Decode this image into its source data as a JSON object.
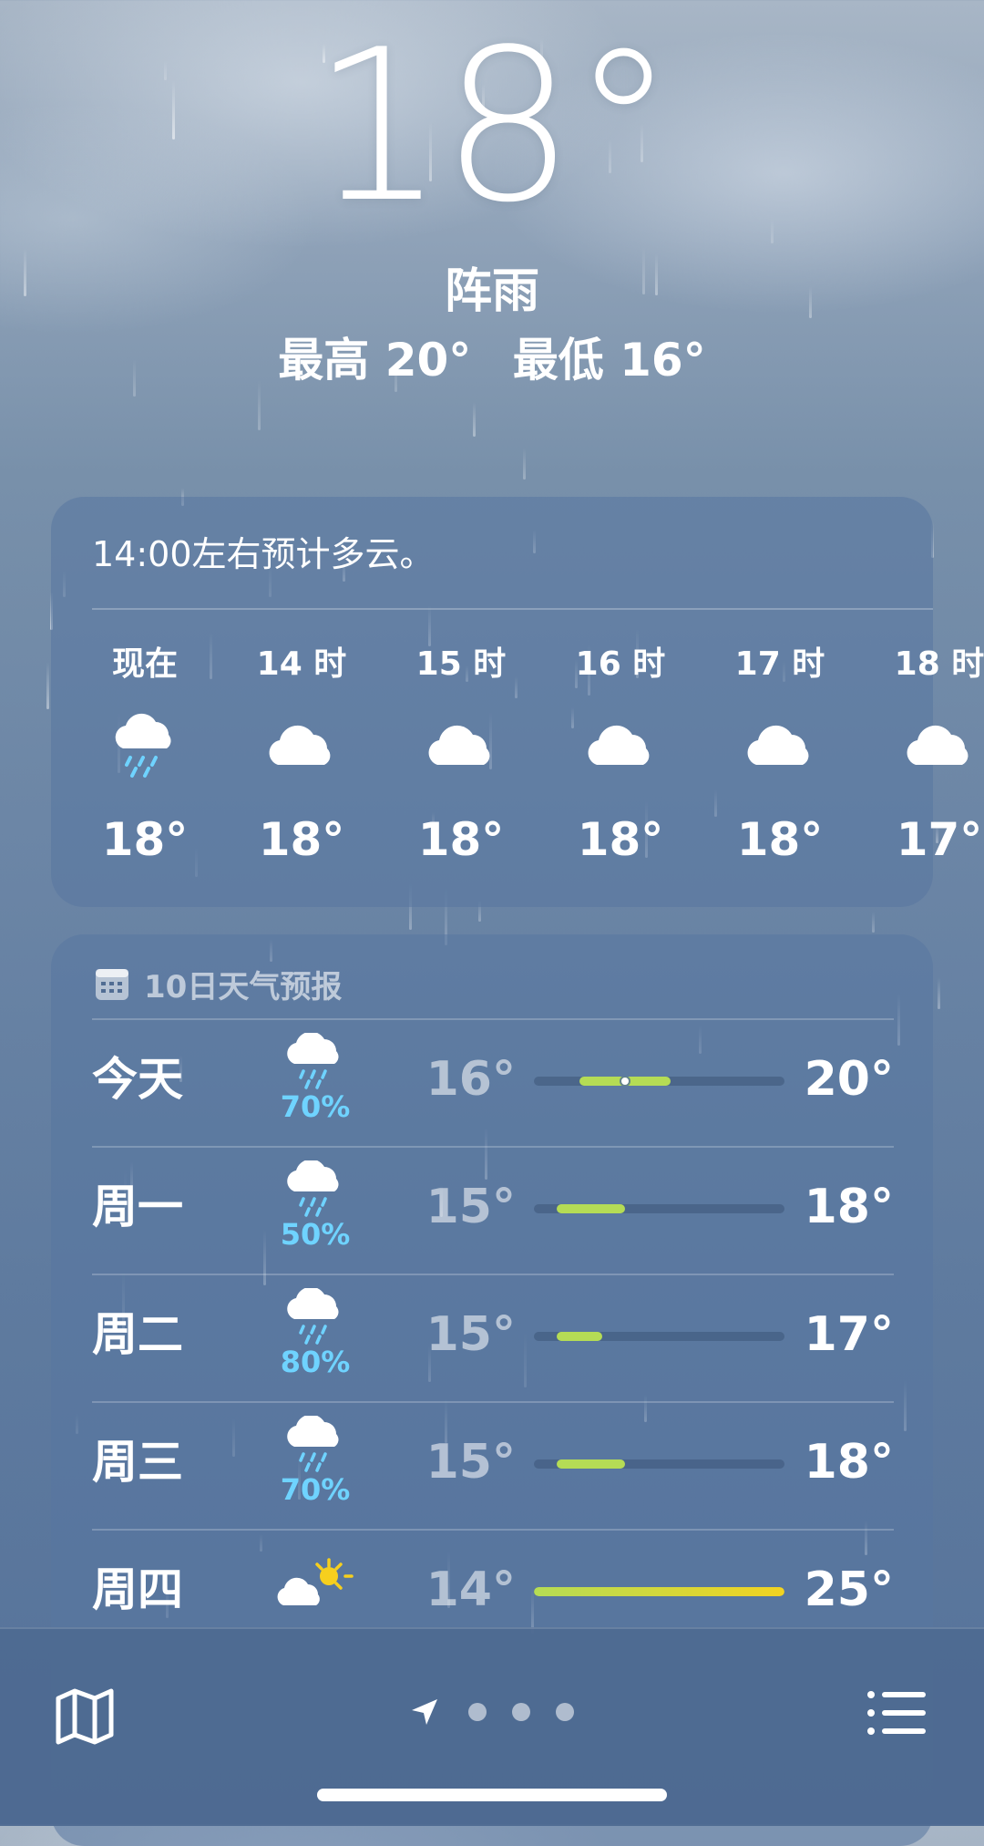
{
  "current": {
    "temperature": "18°",
    "condition": "阵雨",
    "high": "最高 20°",
    "low": "最低 16°"
  },
  "hourly": {
    "summary": "14:00左右预计多云。",
    "items": [
      {
        "time": "现在",
        "icon": "cloud-rain-icon",
        "temp": "18°"
      },
      {
        "time": "14 时",
        "icon": "cloud-icon",
        "temp": "18°"
      },
      {
        "time": "15 时",
        "icon": "cloud-icon",
        "temp": "18°"
      },
      {
        "time": "16 时",
        "icon": "cloud-icon",
        "temp": "18°"
      },
      {
        "time": "17 时",
        "icon": "cloud-icon",
        "temp": "18°"
      },
      {
        "time": "18 时",
        "icon": "cloud-icon",
        "temp": "17°"
      }
    ]
  },
  "daily": {
    "title": "10日天气预报",
    "range_min": 14,
    "range_max": 25,
    "days": [
      {
        "name": "今天",
        "icon": "cloud-rain-icon",
        "precip": "70%",
        "low": "16°",
        "high": "20°",
        "low_val": 16,
        "high_val": 20,
        "current_val": 18
      },
      {
        "name": "周一",
        "icon": "cloud-rain-icon",
        "precip": "50%",
        "low": "15°",
        "high": "18°",
        "low_val": 15,
        "high_val": 18
      },
      {
        "name": "周二",
        "icon": "cloud-rain-icon",
        "precip": "80%",
        "low": "15°",
        "high": "17°",
        "low_val": 15,
        "high_val": 17
      },
      {
        "name": "周三",
        "icon": "cloud-rain-icon",
        "precip": "70%",
        "low": "15°",
        "high": "18°",
        "low_val": 15,
        "high_val": 18
      },
      {
        "name": "周四",
        "icon": "partly-sunny-icon",
        "precip": "",
        "low": "14°",
        "high": "25°",
        "low_val": 14,
        "high_val": 25
      }
    ]
  },
  "colors": {
    "precip": "#6fd3ff",
    "bar_cool": "#b5dc55",
    "bar_warm": "#f2d321"
  },
  "tabbar": {
    "left_icon": "map-icon",
    "right_icon": "list-icon",
    "pages": 3
  }
}
